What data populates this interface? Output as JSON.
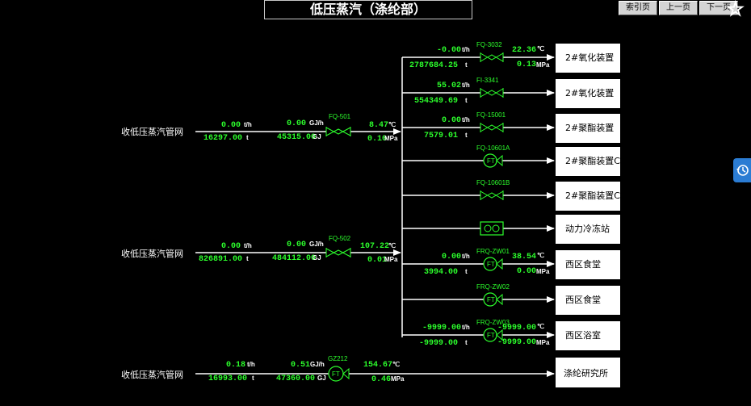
{
  "title": "低压蒸汽（涤纶部）",
  "nav": {
    "index": "索引页",
    "prev": "上一页",
    "next": "下一页"
  },
  "sources": [
    {
      "name": "收低压蒸汽管网",
      "flow": "0.00",
      "flow_unit": "t/h",
      "total": "16297.00",
      "total_unit": "t",
      "energy": "0.00",
      "energy_unit": "GJ/h",
      "energy_total": "45315.00",
      "energy_total_unit": "GJ",
      "tag": "FQ-501",
      "temp": "8.47",
      "temp_unit": "℃",
      "press": "0.10",
      "press_unit": "MPa"
    },
    {
      "name": "收低压蒸汽管网",
      "flow": "0.00",
      "flow_unit": "t/h",
      "total": "826891.00",
      "total_unit": "t",
      "energy": "0.00",
      "energy_unit": "GJ/h",
      "energy_total": "484112.00",
      "energy_total_unit": "GJ",
      "tag": "FQ-502",
      "temp": "107.22",
      "temp_unit": "℃",
      "press": "0.01",
      "press_unit": "MPa"
    },
    {
      "name": "收低压蒸汽管网",
      "flow": "0.18",
      "flow_unit": "t/h",
      "total": "16993.00",
      "total_unit": "t",
      "energy": "0.51",
      "energy_unit": "GJ/h",
      "energy_total": "47360.00",
      "energy_total_unit": "GJ",
      "tag": "GZ212",
      "temp": "154.67",
      "temp_unit": "℃",
      "press": "0.46",
      "press_unit": "MPa"
    }
  ],
  "branches": [
    {
      "dest": "2#氧化装置",
      "tag": "FQ-3032",
      "flow": "-0.00",
      "flow_unit": "t/h",
      "total": "2787684.25",
      "total_unit": "t",
      "temp": "22.36",
      "temp_unit": "℃",
      "press": "0.13",
      "press_unit": "MPa"
    },
    {
      "dest": "2#氧化装置",
      "tag": "FI-3341",
      "flow": "55.02",
      "flow_unit": "t/h",
      "total": "554349.69",
      "total_unit": "t"
    },
    {
      "dest": "2#聚酯装置",
      "tag": "FQ-15001",
      "flow": "0.00",
      "flow_unit": "t/h",
      "total": "7579.01",
      "total_unit": "t"
    },
    {
      "dest": "2#聚酯装置C",
      "tag": "FQ-10601A"
    },
    {
      "dest": "2#聚酯装置C",
      "tag": "FQ-10601B"
    },
    {
      "dest": "动力冷冻站",
      "tag": ""
    },
    {
      "dest": "西区食堂",
      "tag": "FRQ-ZW01",
      "flow": "0.00",
      "flow_unit": "t/h",
      "total": "3994.00",
      "total_unit": "t",
      "temp": "38.54",
      "temp_unit": "℃",
      "press": "0.00",
      "press_unit": "MPa"
    },
    {
      "dest": "西区食堂",
      "tag": "FRQ-ZW02"
    },
    {
      "dest": "西区浴室",
      "tag": "FRQ-ZW03",
      "flow": "-9999.00",
      "flow_unit": "t/h",
      "total": "-9999.00",
      "total_unit": "t",
      "temp": "-9999.00",
      "temp_unit": "℃",
      "press": "-9999.00",
      "press_unit": "MPa"
    }
  ],
  "bottom_dest": "涤纶研究所",
  "meter_label": "FT"
}
